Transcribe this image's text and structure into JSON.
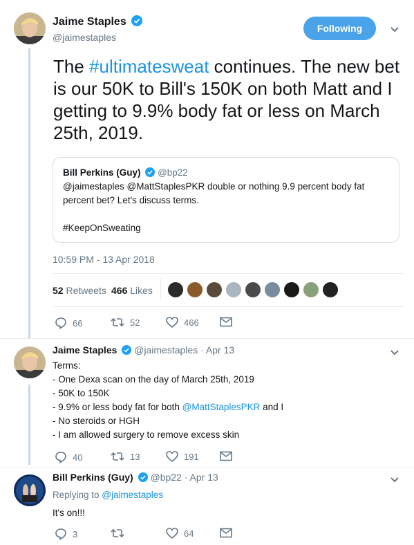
{
  "main": {
    "author_name": "Jaime Staples",
    "author_handle": "@jaimestaples",
    "follow_label": "Following",
    "text_prefix": "The ",
    "hashtag": "#ultimatesweat",
    "text_suffix": " continues. The new bet is our 50K to Bill's 150K on both Matt and I getting to 9.9% body fat or less on March 25th, 2019.",
    "quote": {
      "name": "Bill Perkins (Guy)",
      "handle": "@bp22",
      "line1": "@jaimestaples @MattStaplesPKR double or nothing 9.9 percent body fat percent bet? Let's discuss terms.",
      "line2": "#KeepOnSweating"
    },
    "timestamp": "10:59 PM - 13 Apr 2018",
    "retweets_count": "52",
    "retweets_label": "Retweets",
    "likes_count": "466",
    "likes_label": "Likes",
    "actions": {
      "replies": "66",
      "retweets": "52",
      "likes": "466"
    }
  },
  "reply1": {
    "name": "Jaime Staples",
    "handle": "@jaimestaples",
    "date": "Apr 13",
    "lines": [
      "Terms:",
      "- One Dexa scan on the day of March 25th, 2019",
      "- 50K to 150K"
    ],
    "line_bodyfat_prefix": "- 9.9% or less body fat for both ",
    "line_bodyfat_mention": "@MattStaplesPKR",
    "line_bodyfat_suffix": " and I",
    "lines_after": [
      "- No steroids or HGH",
      "- I am allowed surgery to remove excess skin"
    ],
    "actions": {
      "replies": "40",
      "retweets": "13",
      "likes": "191"
    }
  },
  "reply2": {
    "name": "Bill Perkins (Guy)",
    "handle": "@bp22",
    "date": "Apr 13",
    "replying_to_label": "Replying to ",
    "replying_to_handle": "@jaimestaples",
    "text": "It's on!!!",
    "actions": {
      "replies": "3",
      "likes": "64"
    }
  },
  "separator": "·",
  "colors": {
    "accent": "#1b95e0",
    "follow_bg": "#4aa3e8",
    "muted": "#657786",
    "border": "#e6ecf0"
  }
}
